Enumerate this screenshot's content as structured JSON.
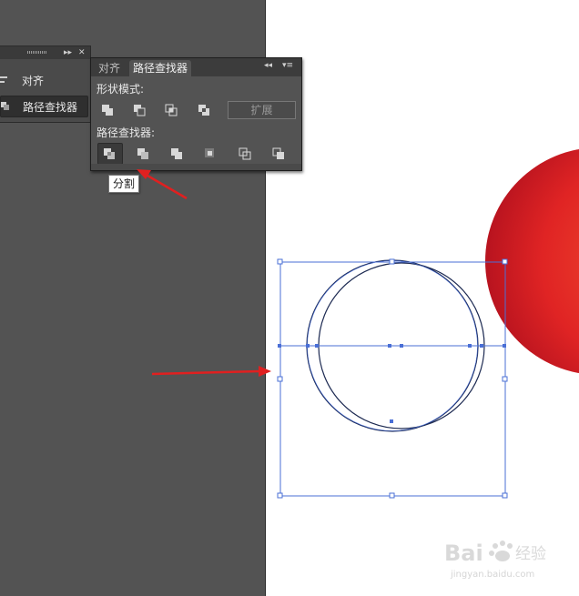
{
  "side_panel": {
    "items": [
      {
        "label": "对齐"
      },
      {
        "label": "路径查找器"
      }
    ]
  },
  "pathfinder_panel": {
    "tabs": [
      {
        "label": "对齐"
      },
      {
        "label": "路径查找器"
      }
    ],
    "shape_modes_label": "形状模式:",
    "expand_label": "扩展",
    "pathfinders_label": "路径查找器:"
  },
  "tooltip": {
    "text": "分割"
  },
  "watermark": {
    "logo": "Bai",
    "sub": "jingyan.baidu.com"
  },
  "colors": {
    "workspace": "#535353",
    "panel": "#535353",
    "selection": "#4a6fd6",
    "arrow": "#e02020",
    "red_circle": "#e02424"
  }
}
